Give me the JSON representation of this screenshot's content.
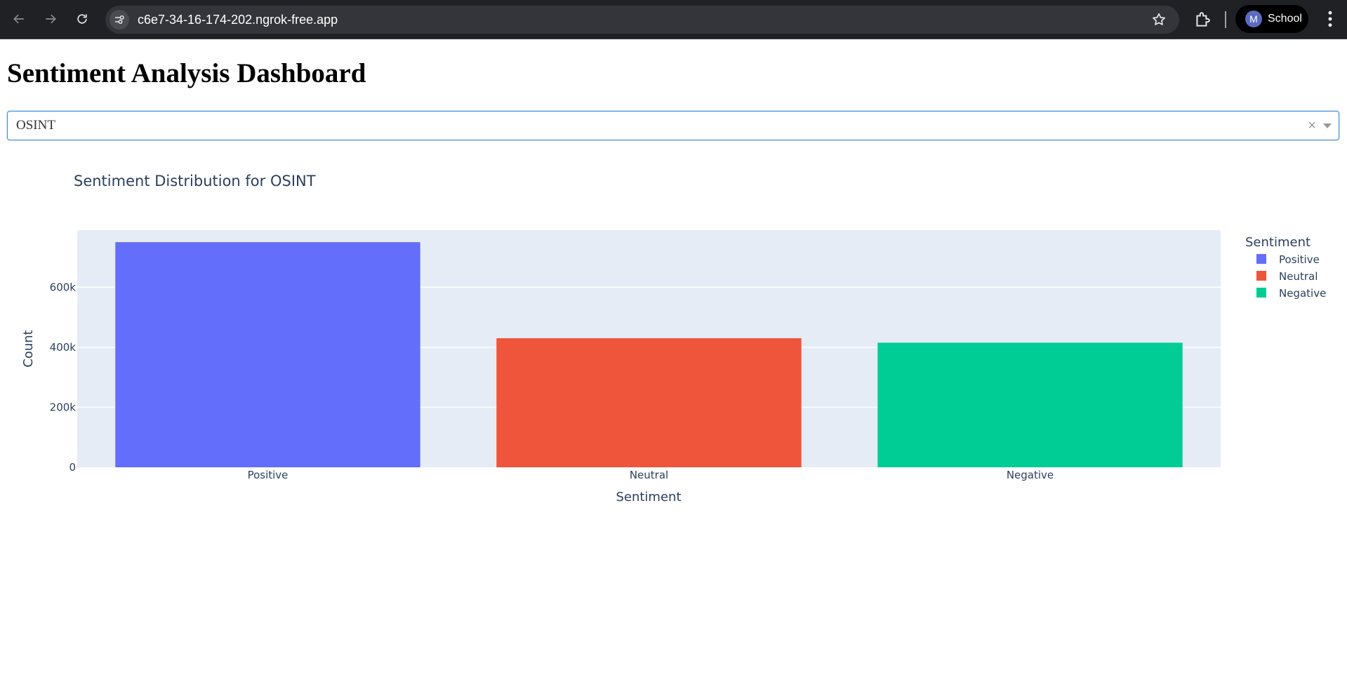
{
  "browser": {
    "url": "c6e7-34-16-174-202.ngrok-free.app",
    "profile_initial": "M",
    "profile_name": "School"
  },
  "page": {
    "title": "Sentiment Analysis Dashboard"
  },
  "dropdown": {
    "selected": "OSINT",
    "clear_symbol": "×"
  },
  "colors": {
    "plot_bg": "#e5ecf6",
    "text": "#2a3f5f"
  },
  "chart_data": {
    "type": "bar",
    "title": "Sentiment Distribution for OSINT",
    "xlabel": "Sentiment",
    "ylabel": "Count",
    "categories": [
      "Positive",
      "Neutral",
      "Negative"
    ],
    "values": [
      750000,
      430000,
      415000
    ],
    "colors": [
      "#636efa",
      "#ef553b",
      "#00cc96"
    ],
    "ylim": [
      0,
      790000
    ],
    "yticks": [
      0,
      200000,
      400000,
      600000
    ],
    "ytick_labels": [
      "0",
      "200k",
      "400k",
      "600k"
    ],
    "grid": true,
    "legend": {
      "title": "Sentiment",
      "position": "right",
      "entries": [
        "Positive",
        "Neutral",
        "Negative"
      ]
    }
  }
}
